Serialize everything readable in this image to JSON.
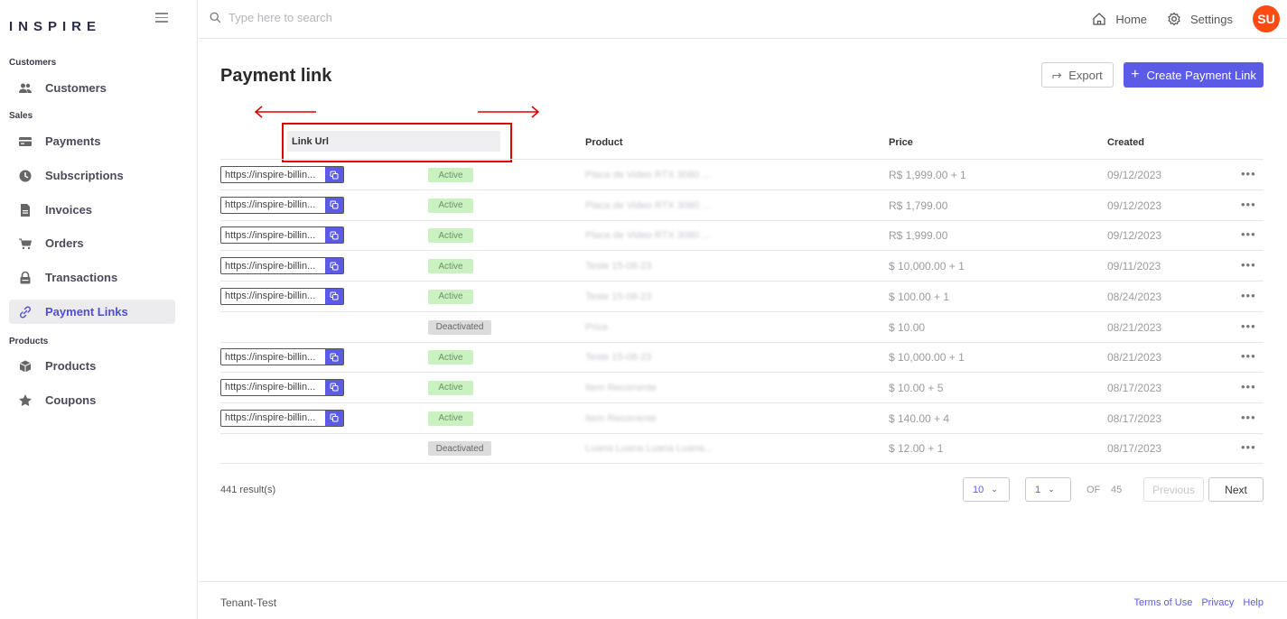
{
  "app": {
    "logo": "INSPIRE"
  },
  "search": {
    "placeholder": "Type here to search"
  },
  "header": {
    "home_label": "Home",
    "settings_label": "Settings",
    "avatar_initials": "SU"
  },
  "sidebar": {
    "sections": [
      "Customers",
      "Sales",
      "Products"
    ],
    "items": [
      {
        "label": "Customers",
        "icon": "users-icon"
      },
      {
        "label": "Payments",
        "icon": "card-icon"
      },
      {
        "label": "Subscriptions",
        "icon": "clock-icon"
      },
      {
        "label": "Invoices",
        "icon": "document-icon"
      },
      {
        "label": "Orders",
        "icon": "cart-icon"
      },
      {
        "label": "Transactions",
        "icon": "lock-icon"
      },
      {
        "label": "Payment Links",
        "icon": "link-icon",
        "active": true
      },
      {
        "label": "Products",
        "icon": "box-icon"
      },
      {
        "label": "Coupons",
        "icon": "star-icon"
      }
    ]
  },
  "page": {
    "title": "Payment link",
    "export_label": "Export",
    "create_label": "Create Payment Link"
  },
  "table": {
    "columns": {
      "link_url": "Link Url",
      "product": "Product",
      "price": "Price",
      "created": "Created"
    },
    "rows": [
      {
        "url": "https://inspire-billin...",
        "status": "Active",
        "product": "Placa de Video RTX 3080 ...",
        "price": "R$ 1,999.00 + 1",
        "created": "09/12/2023"
      },
      {
        "url": "https://inspire-billin...",
        "status": "Active",
        "product": "Placa de Video RTX 3080 ...",
        "price": "R$ 1,799.00",
        "created": "09/12/2023"
      },
      {
        "url": "https://inspire-billin...",
        "status": "Active",
        "product": "Placa de Video RTX 3080 ...",
        "price": "R$ 1,999.00",
        "created": "09/12/2023"
      },
      {
        "url": "https://inspire-billin...",
        "status": "Active",
        "product": "Teste 15-08-23",
        "price": "$ 10,000.00 + 1",
        "created": "09/11/2023"
      },
      {
        "url": "https://inspire-billin...",
        "status": "Active",
        "product": "Teste 15-08-23",
        "price": "$ 100.00 + 1",
        "created": "08/24/2023"
      },
      {
        "url": "",
        "status": "Deactivated",
        "product": "Price",
        "price": "$ 10.00",
        "created": "08/21/2023"
      },
      {
        "url": "https://inspire-billin...",
        "status": "Active",
        "product": "Teste 15-08-23",
        "price": "$ 10,000.00 + 1",
        "created": "08/21/2023"
      },
      {
        "url": "https://inspire-billin...",
        "status": "Active",
        "product": "Item Recorrente",
        "price": "$ 10.00 + 5",
        "created": "08/17/2023"
      },
      {
        "url": "https://inspire-billin...",
        "status": "Active",
        "product": "Item Recorrente",
        "price": "$ 140.00 + 4",
        "created": "08/17/2023"
      },
      {
        "url": "",
        "status": "Deactivated",
        "product": "Luana Luana Luana Luana...",
        "price": "$ 12.00 + 1",
        "created": "08/17/2023"
      }
    ],
    "more_label": "•••"
  },
  "pagination": {
    "results": "441 result(s)",
    "page_size": "10",
    "page": "1",
    "of_label": "OF",
    "total_pages": "45",
    "previous_label": "Previous",
    "next_label": "Next"
  },
  "footer": {
    "tenant": "Tenant-Test",
    "links": [
      "Terms of Use",
      "Privacy",
      "Help"
    ]
  },
  "colors": {
    "accent": "#5b5be8",
    "avatar": "#ff4a12",
    "annotation": "#e00000"
  }
}
